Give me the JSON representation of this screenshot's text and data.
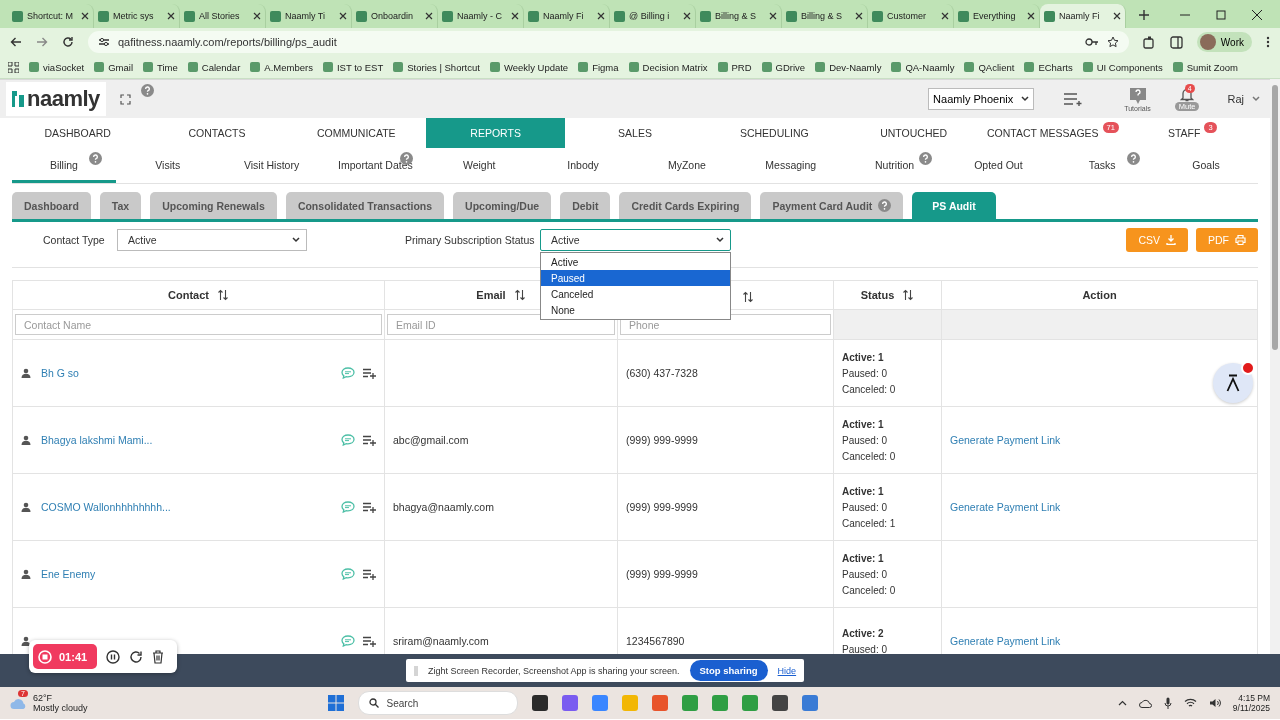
{
  "browser": {
    "tabs": [
      {
        "title": "Shortcut: M",
        "selected": false
      },
      {
        "title": "Metric sys",
        "selected": false
      },
      {
        "title": "All Stories",
        "selected": false
      },
      {
        "title": "Naamly Ti",
        "selected": false
      },
      {
        "title": "Onboardin",
        "selected": false
      },
      {
        "title": "Naamly - C",
        "selected": false
      },
      {
        "title": "Naamly Fi",
        "selected": false
      },
      {
        "title": "@ Billing i",
        "selected": false
      },
      {
        "title": "Billing & S",
        "selected": false
      },
      {
        "title": "Billing & S",
        "selected": false
      },
      {
        "title": "Customer",
        "selected": false
      },
      {
        "title": "Everything",
        "selected": false
      },
      {
        "title": "Naamly Fi",
        "selected": true
      }
    ],
    "url": "qafitness.naamly.com/reports/billing/ps_audit",
    "bookmarks": [
      "viaSocket",
      "Gmail",
      "Time",
      "Calendar",
      "A.Members",
      "IST to EST",
      "Stories | Shortcut",
      "Weekly Update",
      "Figma",
      "Decision Matrix",
      "PRD",
      "GDrive",
      "Dev-Naamly",
      "QA-Naamly",
      "QAclient",
      "ECharts",
      "UI Components",
      "Sumit Zoom"
    ],
    "profile": "Work"
  },
  "app": {
    "logo": "naamly",
    "location": "Naamly Phoenix",
    "tutorials": "Tutorials",
    "notifications": "4",
    "mute": "Mute",
    "user": "Raj"
  },
  "main_nav": [
    {
      "label": "DASHBOARD",
      "selected": false
    },
    {
      "label": "CONTACTS",
      "selected": false
    },
    {
      "label": "COMMUNICATE",
      "selected": false
    },
    {
      "label": "REPORTS",
      "selected": true
    },
    {
      "label": "SALES",
      "selected": false
    },
    {
      "label": "SCHEDULING",
      "selected": false
    },
    {
      "label": "UNTOUCHED",
      "selected": false
    },
    {
      "label": "CONTACT MESSAGES",
      "selected": false,
      "badge": "71"
    },
    {
      "label": "STAFF",
      "selected": false,
      "badge": "3"
    }
  ],
  "sub_nav": [
    {
      "label": "Billing",
      "selected": true,
      "help": true
    },
    {
      "label": "Visits",
      "selected": false,
      "help": false
    },
    {
      "label": "Visit History",
      "selected": false,
      "help": false
    },
    {
      "label": "Important Dates",
      "selected": false,
      "help": true
    },
    {
      "label": "Weight",
      "selected": false,
      "help": false
    },
    {
      "label": "Inbody",
      "selected": false,
      "help": false
    },
    {
      "label": "MyZone",
      "selected": false,
      "help": false
    },
    {
      "label": "Messaging",
      "selected": false,
      "help": false
    },
    {
      "label": "Nutrition",
      "selected": false,
      "help": true
    },
    {
      "label": "Opted Out",
      "selected": false,
      "help": false
    },
    {
      "label": "Tasks",
      "selected": false,
      "help": true
    },
    {
      "label": "Goals",
      "selected": false,
      "help": false
    }
  ],
  "report_tabs": [
    {
      "label": "Dashboard",
      "selected": false,
      "help": false
    },
    {
      "label": "Tax",
      "selected": false,
      "help": false
    },
    {
      "label": "Upcoming Renewals",
      "selected": false,
      "help": false
    },
    {
      "label": "Consolidated Transactions",
      "selected": false,
      "help": false
    },
    {
      "label": "Upcoming/Due",
      "selected": false,
      "help": false
    },
    {
      "label": "Debit",
      "selected": false,
      "help": false
    },
    {
      "label": "Credit Cards Expiring",
      "selected": false,
      "help": false
    },
    {
      "label": "Payment Card Audit",
      "selected": false,
      "help": true
    },
    {
      "label": "PS Audit",
      "selected": true,
      "help": false
    }
  ],
  "filters": {
    "contact_type": {
      "label": "Contact Type",
      "value": "Active"
    },
    "subscription_status": {
      "label": "Primary Subscription Status",
      "value": "Active",
      "options": [
        {
          "label": "Active",
          "highlighted": false
        },
        {
          "label": "Paused",
          "highlighted": true
        },
        {
          "label": "Canceled",
          "highlighted": false
        },
        {
          "label": "None",
          "highlighted": false
        }
      ]
    }
  },
  "exports": [
    {
      "label": "CSV",
      "kind": "download"
    },
    {
      "label": "PDF",
      "kind": "print"
    }
  ],
  "table": {
    "columns": [
      {
        "label": "Contact",
        "sortable": true
      },
      {
        "label": "Email",
        "sortable": true
      },
      {
        "sortable": true
      },
      {
        "label": "Status",
        "sortable": true
      },
      {
        "label": "Action",
        "sortable": false
      }
    ],
    "filters": [
      "Contact Name",
      "Email ID",
      "Phone"
    ],
    "rows": [
      {
        "contact": "Bh G so",
        "phone": "(630) 437-7328",
        "status": [
          "Active: 1",
          "Paused: 0",
          "Canceled: 0"
        ]
      },
      {
        "contact": "Bhagya lakshmi Mami...",
        "email": "abc@gmail.com",
        "phone": "(999) 999-9999",
        "status": [
          "Active: 1",
          "Paused: 0",
          "Canceled: 0"
        ],
        "action": "Generate Payment Link"
      },
      {
        "contact": "COSMO Wallonhhhhhhhh...",
        "email": "bhagya@naamly.com",
        "phone": "(999) 999-9999",
        "status": [
          "Active: 1",
          "Paused: 0",
          "Canceled: 1"
        ],
        "action": "Generate Payment Link"
      },
      {
        "contact": "Ene Enemy",
        "phone": "(999) 999-9999",
        "status": [
          "Active: 1",
          "Paused: 0",
          "Canceled: 0"
        ]
      },
      {
        "email": "sriram@naamly.com",
        "phone": "1234567890",
        "status": [
          "Active: 2",
          "Paused: 0"
        ],
        "action": "Generate Payment Link"
      }
    ]
  },
  "recorder": {
    "time": "01:41"
  },
  "share_bar": {
    "message": "Zight Screen Recorder, Screenshot App is sharing your screen.",
    "stop": "Stop sharing",
    "hide": "Hide"
  },
  "taskbar": {
    "weather_badge": "7",
    "temperature": "62°F",
    "condition": "Mostly cloudy",
    "search": "Search",
    "time": "4:15 PM",
    "date": "9/11/2025"
  }
}
